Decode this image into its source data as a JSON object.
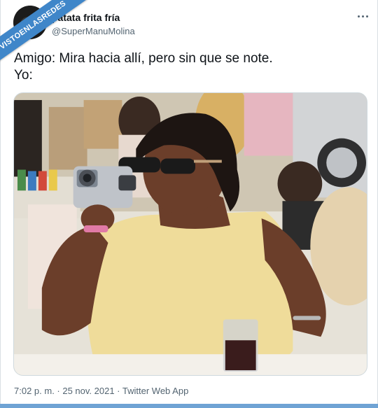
{
  "watermark": {
    "text": "VISTOENLASREDES"
  },
  "tweet": {
    "display_name": "patata frita fría",
    "handle": "@SuperManuMolina",
    "text": "Amigo: Mira hacia allí, pero sin que se note.\nYo:",
    "timestamp": "7:02 p. m. · 25 nov. 2021 · ",
    "source": "Twitter Web App"
  },
  "icons": {
    "more": "more-horizontal-icon"
  },
  "colors": {
    "accent": "#3f86c9",
    "secondary_text": "#536471",
    "text": "#0f1419"
  }
}
